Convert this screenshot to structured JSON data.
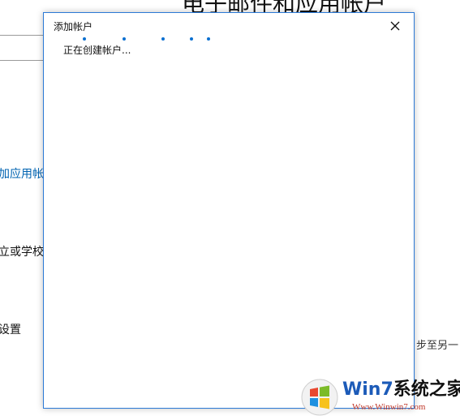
{
  "background": {
    "title": "电子邮件和应用帐户",
    "link_text": "加应用帐户",
    "item_text": "立或学校帐",
    "settings_text": "设置",
    "sync_text": "步至另一"
  },
  "dialog": {
    "title": "添加帐户",
    "status_text": "正在创建帐户..."
  },
  "watermark": {
    "title_prefix": "Win7",
    "title_suffix": "系统之家",
    "url": "Www.Winwin7.com"
  },
  "colors": {
    "accent": "#0a6fd0",
    "dialog_border": "#2b79d6",
    "link": "#0063b1"
  }
}
